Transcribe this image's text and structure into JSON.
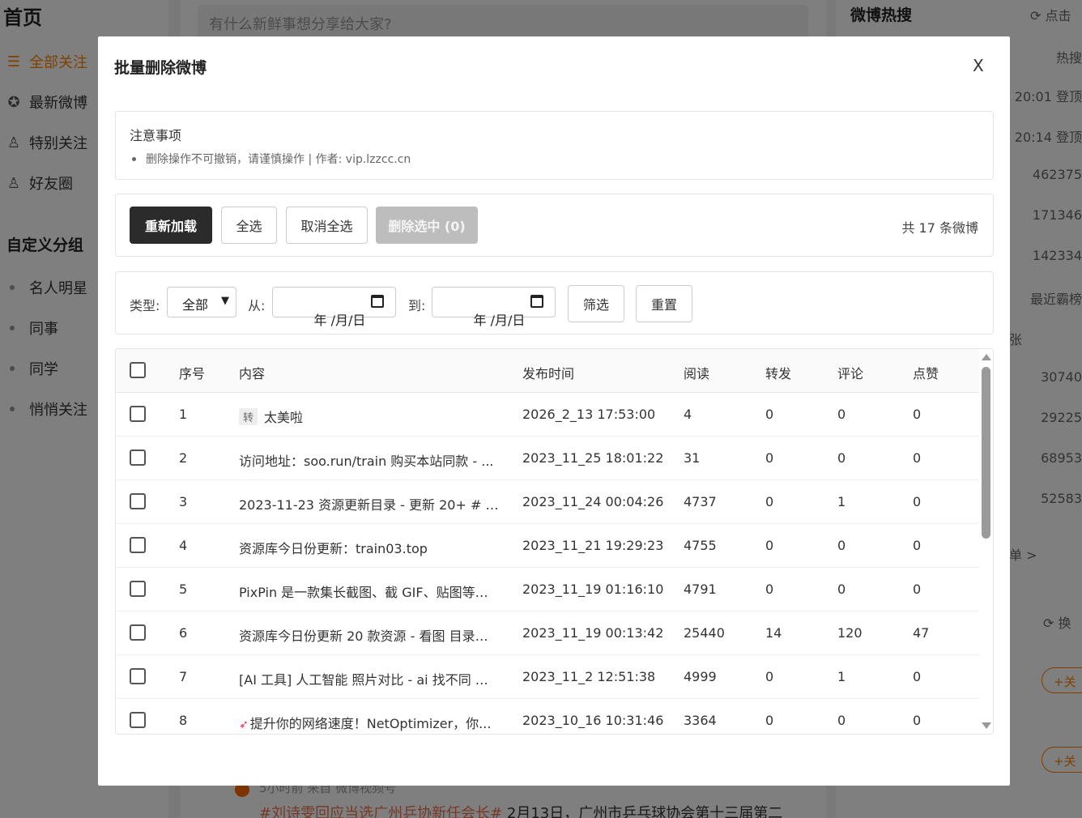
{
  "background": {
    "left": {
      "title": "首页",
      "nav": [
        {
          "label": "全部关注",
          "icon": "list-icon",
          "active": true
        },
        {
          "label": "最新微博",
          "icon": "star-circle-icon",
          "active": false
        },
        {
          "label": "特别关注",
          "icon": "user-star-icon",
          "active": false
        },
        {
          "label": "好友圈",
          "icon": "user-group-icon",
          "active": false
        }
      ],
      "group_title": "自定义分组",
      "groups": [
        "名人明星",
        "同事",
        "同学",
        "悄悄关注"
      ]
    },
    "center": {
      "compose_placeholder": "有什么新鲜事想分享给大家?",
      "feed_meta": "5小时前 来自 微博视频号",
      "feed_tag": "#刘诗雯回应当选广州乒协新任会长#",
      "feed_text": " 2月13日，广州市乒乓球协会第十三届第二"
    },
    "right": {
      "title": "微博热搜",
      "refresh": "点击",
      "rows": [
        "热搜",
        "20:01 登顶",
        "20:14 登顶",
        "462375",
        "171346",
        "142334",
        "最近霸榜",
        "张",
        "30740",
        "29225",
        "68953",
        "52583",
        "单 >"
      ],
      "swap": "换",
      "follow": "+关"
    },
    "accent": "#ff8200"
  },
  "modal": {
    "title": "批量删除微博",
    "close": "X",
    "notice": {
      "title": "注意事项",
      "item": "删除操作不可撤销，请谨慎操作 | 作者: vip.lzzcc.cn"
    },
    "toolbar": {
      "reload": "重新加载",
      "select_all": "全选",
      "deselect_all": "取消全选",
      "delete_selected": "删除选中 (0)",
      "total": "共 17 条微博"
    },
    "filter": {
      "type_label": "类型:",
      "type_value": "全部",
      "from_label": "从:",
      "from_value": "年 /月/日",
      "to_label": "到:",
      "to_value": "年 /月/日",
      "filter_btn": "筛选",
      "reset_btn": "重置"
    },
    "table": {
      "headers": [
        "序号",
        "内容",
        "发布时间",
        "阅读",
        "转发",
        "评论",
        "点赞"
      ],
      "rows": [
        {
          "idx": "1",
          "content": "太美啦",
          "repost": true,
          "time": "2026_2_13 17:53:00",
          "read": "4",
          "fwd": "0",
          "cmt": "0",
          "like": "0"
        },
        {
          "idx": "2",
          "content": "访问地址：soo.run/train 购买本站同款 - ...",
          "time": "2023_11_25 18:01:22",
          "read": "31",
          "fwd": "0",
          "cmt": "0",
          "like": "0"
        },
        {
          "idx": "3",
          "content": "2023-11-23 资源更新目录 - 更新 20+ # 软...",
          "time": "2023_11_24 00:04:26",
          "read": "4737",
          "fwd": "0",
          "cmt": "1",
          "like": "0"
        },
        {
          "idx": "4",
          "content": "资源库今日份更新：train03.top",
          "time": "2023_11_21 19:29:23",
          "read": "4755",
          "fwd": "0",
          "cmt": "0",
          "like": "0"
        },
        {
          "idx": "5",
          "content": "PixPin 是一款集长截图、截 GIF、贴图等功...",
          "time": "2023_11_19 01:16:10",
          "read": "4791",
          "fwd": "0",
          "cmt": "0",
          "like": "0"
        },
        {
          "idx": "6",
          "content": "资源库今日份更新 20 款资源 - 看图 目录地...",
          "time": "2023_11_19 00:13:42",
          "read": "25440",
          "fwd": "14",
          "cmt": "120",
          "like": "47"
        },
        {
          "idx": "7",
          "content": "[AI 工具] 人工智能 照片对比 - ai 找不同 ",
          "emoji": true,
          "time": "2023_11_2 12:51:38",
          "read": "4999",
          "fwd": "0",
          "cmt": "1",
          "like": "0"
        },
        {
          "idx": "8",
          "content": "提升你的网络速度！NetOptimizer，你...",
          "rocket": true,
          "time": "2023_10_16 10:31:46",
          "read": "3364",
          "fwd": "0",
          "cmt": "0",
          "like": "0"
        }
      ],
      "repost_tag": "转",
      "emoji_suffix": "..."
    }
  }
}
